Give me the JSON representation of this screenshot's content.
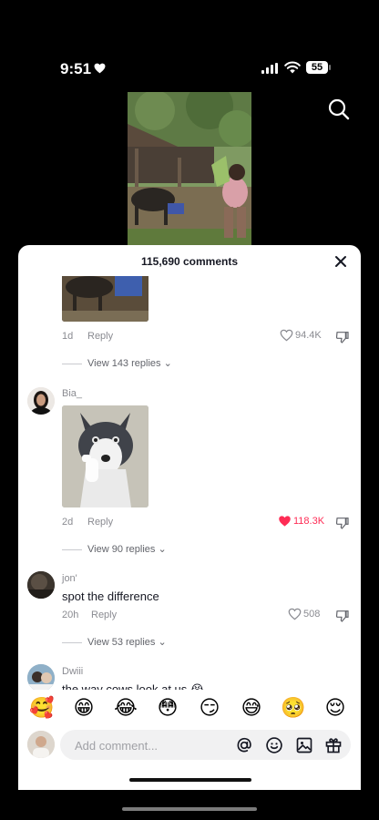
{
  "status_bar": {
    "time": "9:51",
    "battery": "55"
  },
  "sheet": {
    "comment_count": "115,690 comments"
  },
  "comments": [
    {
      "age": "1d",
      "reply": "Reply",
      "likes": "94.4K",
      "liked": false,
      "view_replies": "View 143 replies"
    },
    {
      "username": "Bia_",
      "age": "2d",
      "reply": "Reply",
      "likes": "118.3K",
      "liked": true,
      "view_replies": "View 90 replies"
    },
    {
      "username": "jon'",
      "text": "spot the difference",
      "age": "20h",
      "reply": "Reply",
      "likes": "508",
      "liked": false,
      "view_replies": "View 53 replies"
    },
    {
      "username": "Dwiii",
      "text": "the way cows look at us 😭"
    }
  ],
  "emoji_bar": [
    "🥰",
    "😁",
    "😂",
    "😳",
    "😏",
    "😅",
    "🥺",
    "😌"
  ],
  "composer": {
    "placeholder": "Add comment..."
  },
  "colors": {
    "accent_like": "#fe2c55",
    "text_primary": "#161823",
    "text_secondary": "#8a8b91"
  }
}
